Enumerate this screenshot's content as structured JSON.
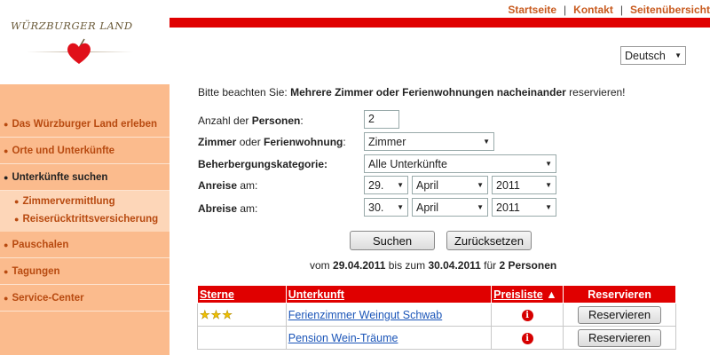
{
  "header": {
    "logo_text": "WÜRZBURGER LAND",
    "links": [
      "Startseite",
      "Kontakt",
      "Seitenübersicht"
    ],
    "language": "Deutsch",
    "accent_color": "#e00000"
  },
  "sidebar": {
    "items": [
      {
        "label": "Das Würzburger Land erleben"
      },
      {
        "label": "Orte und Unterkünfte"
      },
      {
        "label": "Unterkünfte suchen"
      },
      {
        "label": "Pauschalen"
      },
      {
        "label": "Tagungen"
      },
      {
        "label": "Service-Center"
      }
    ],
    "subitems": [
      {
        "label": "Zimmervermittlung"
      },
      {
        "label": "Reiserücktrittsversicherung"
      }
    ],
    "bg_color": "#fbbb8d"
  },
  "notice": {
    "prefix": "Bitte beachten Sie: ",
    "bold": "Mehrere Zimmer oder Ferienwohnungen nacheinander",
    "suffix": " reservieren!"
  },
  "form": {
    "persons_label_a": "Anzahl der ",
    "persons_label_b": "Personen",
    "persons_label_c": ":",
    "persons_value": "2",
    "type_label_a": "Zimmer",
    "type_label_b": " oder ",
    "type_label_c": "Ferienwohnung",
    "type_label_d": ":",
    "type_value": "Zimmer",
    "category_label": "Beherbergungskategorie:",
    "category_value": "Alle Unterkünfte",
    "arrival_label_a": "Anreise",
    "arrival_label_b": " am:",
    "arrival_day": "29.",
    "arrival_month": "April",
    "arrival_year": "2011",
    "departure_label_a": "Abreise",
    "departure_label_b": " am:",
    "departure_day": "30.",
    "departure_month": "April",
    "departure_year": "2011",
    "search_button": "Suchen",
    "reset_button": "Zurücksetzen"
  },
  "summary": {
    "from_word": "vom ",
    "from_date": "29.04.2011",
    "to_word": " bis zum ",
    "to_date": "30.04.2011",
    "for_word": " für ",
    "persons": "2 Personen"
  },
  "results": {
    "columns": [
      "Sterne",
      "Unterkunft",
      "Preisliste",
      "Reservieren"
    ],
    "sort_indicator": "▲",
    "rows": [
      {
        "stars": "★★★",
        "name": "Ferienzimmer Weingut Schwab",
        "info": "i",
        "button": "Reservieren"
      },
      {
        "stars": "",
        "name": "Pension Wein-Träume",
        "info": "i",
        "button": "Reservieren"
      }
    ]
  }
}
